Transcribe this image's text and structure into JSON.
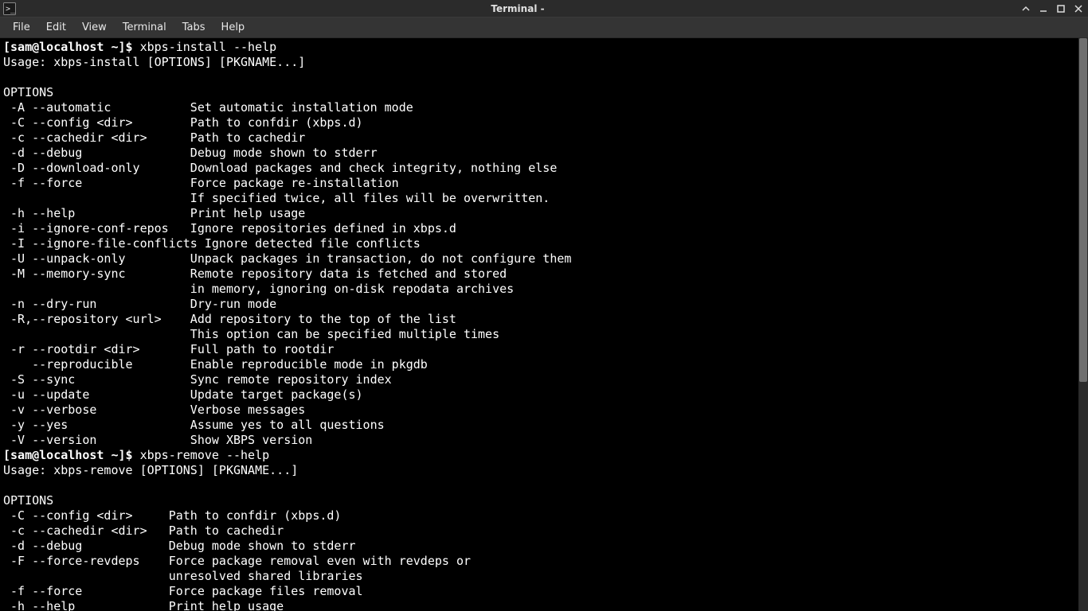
{
  "window": {
    "title": "Terminal -"
  },
  "menubar": {
    "items": [
      "File",
      "Edit",
      "View",
      "Terminal",
      "Tabs",
      "Help"
    ]
  },
  "term": {
    "prompt1": "[sam@localhost ~]$ ",
    "cmd1": "xbps-install --help",
    "out1_usage": "Usage: xbps-install [OPTIONS] [PKGNAME...]",
    "out1_blank": "",
    "out1_opts_hdr": "OPTIONS",
    "out1_l1": " -A --automatic           Set automatic installation mode",
    "out1_l2": " -C --config <dir>        Path to confdir (xbps.d)",
    "out1_l3": " -c --cachedir <dir>      Path to cachedir",
    "out1_l4": " -d --debug               Debug mode shown to stderr",
    "out1_l5": " -D --download-only       Download packages and check integrity, nothing else",
    "out1_l6": " -f --force               Force package re-installation",
    "out1_l7": "                          If specified twice, all files will be overwritten.",
    "out1_l8": " -h --help                Print help usage",
    "out1_l9": " -i --ignore-conf-repos   Ignore repositories defined in xbps.d",
    "out1_l10": " -I --ignore-file-conflicts Ignore detected file conflicts",
    "out1_l11": " -U --unpack-only         Unpack packages in transaction, do not configure them",
    "out1_l12": " -M --memory-sync         Remote repository data is fetched and stored",
    "out1_l13": "                          in memory, ignoring on-disk repodata archives",
    "out1_l14": " -n --dry-run             Dry-run mode",
    "out1_l15": " -R,--repository <url>    Add repository to the top of the list",
    "out1_l16": "                          This option can be specified multiple times",
    "out1_l17": " -r --rootdir <dir>       Full path to rootdir",
    "out1_l18": "    --reproducible        Enable reproducible mode in pkgdb",
    "out1_l19": " -S --sync                Sync remote repository index",
    "out1_l20": " -u --update              Update target package(s)",
    "out1_l21": " -v --verbose             Verbose messages",
    "out1_l22": " -y --yes                 Assume yes to all questions",
    "out1_l23": " -V --version             Show XBPS version",
    "prompt2": "[sam@localhost ~]$ ",
    "cmd2": "xbps-remove --help",
    "out2_usage": "Usage: xbps-remove [OPTIONS] [PKGNAME...]",
    "out2_blank": "",
    "out2_opts_hdr": "OPTIONS",
    "out2_l1": " -C --config <dir>     Path to confdir (xbps.d)",
    "out2_l2": " -c --cachedir <dir>   Path to cachedir",
    "out2_l3": " -d --debug            Debug mode shown to stderr",
    "out2_l4": " -F --force-revdeps    Force package removal even with revdeps or",
    "out2_l5": "                       unresolved shared libraries",
    "out2_l6": " -f --force            Force package files removal",
    "out2_l7": " -h --help             Print help usage"
  }
}
